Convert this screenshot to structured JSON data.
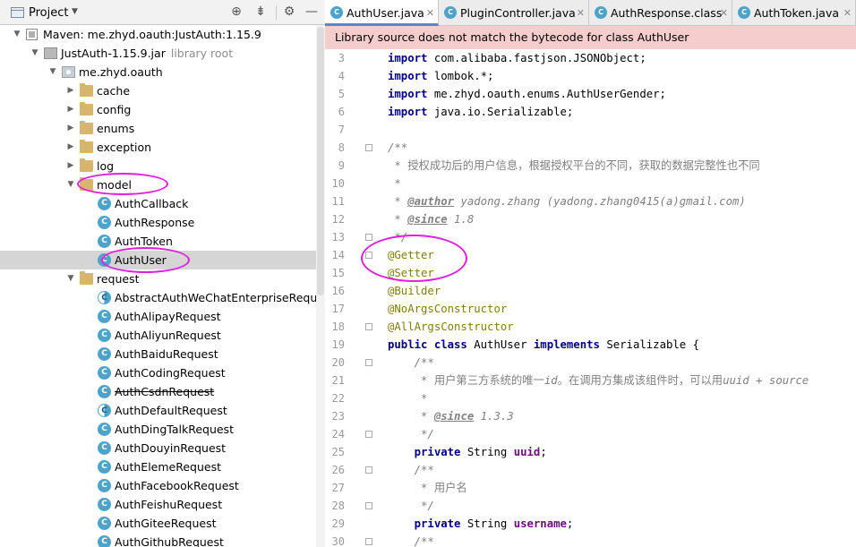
{
  "project_panel": {
    "title": "Project",
    "tree": [
      {
        "depth": 0,
        "arrow": "down",
        "icon": "maven",
        "label": "Maven: me.zhyd.oauth:JustAuth:1.15.9"
      },
      {
        "depth": 1,
        "arrow": "down",
        "icon": "jar",
        "label": "JustAuth-1.15.9.jar",
        "suffix": "library root"
      },
      {
        "depth": 2,
        "arrow": "down",
        "icon": "package",
        "label": "me.zhyd.oauth"
      },
      {
        "depth": 3,
        "arrow": "right",
        "icon": "folder",
        "label": "cache"
      },
      {
        "depth": 3,
        "arrow": "right",
        "icon": "folder",
        "label": "config"
      },
      {
        "depth": 3,
        "arrow": "right",
        "icon": "folder",
        "label": "enums"
      },
      {
        "depth": 3,
        "arrow": "right",
        "icon": "folder",
        "label": "exception"
      },
      {
        "depth": 3,
        "arrow": "right",
        "icon": "folder",
        "label": "log"
      },
      {
        "depth": 3,
        "arrow": "down",
        "icon": "folder",
        "label": "model"
      },
      {
        "depth": 4,
        "icon": "class",
        "label": "AuthCallback"
      },
      {
        "depth": 4,
        "icon": "class",
        "label": "AuthResponse"
      },
      {
        "depth": 4,
        "icon": "class",
        "label": "AuthToken"
      },
      {
        "depth": 4,
        "icon": "class",
        "label": "AuthUser",
        "selected": true
      },
      {
        "depth": 3,
        "arrow": "down",
        "icon": "folder",
        "label": "request"
      },
      {
        "depth": 4,
        "icon": "abstract-class",
        "label": "AbstractAuthWeChatEnterpriseRequest"
      },
      {
        "depth": 4,
        "icon": "class",
        "label": "AuthAlipayRequest"
      },
      {
        "depth": 4,
        "icon": "class",
        "label": "AuthAliyunRequest"
      },
      {
        "depth": 4,
        "icon": "class",
        "label": "AuthBaiduRequest"
      },
      {
        "depth": 4,
        "icon": "class",
        "label": "AuthCodingRequest"
      },
      {
        "depth": 4,
        "icon": "class",
        "label": "AuthCsdnRequest",
        "deprecated": true
      },
      {
        "depth": 4,
        "icon": "abstract-class",
        "label": "AuthDefaultRequest"
      },
      {
        "depth": 4,
        "icon": "class",
        "label": "AuthDingTalkRequest"
      },
      {
        "depth": 4,
        "icon": "class",
        "label": "AuthDouyinRequest"
      },
      {
        "depth": 4,
        "icon": "class",
        "label": "AuthElemeRequest"
      },
      {
        "depth": 4,
        "icon": "class",
        "label": "AuthFacebookRequest"
      },
      {
        "depth": 4,
        "icon": "class",
        "label": "AuthFeishuRequest"
      },
      {
        "depth": 4,
        "icon": "class",
        "label": "AuthGiteeRequest"
      },
      {
        "depth": 4,
        "icon": "class",
        "label": "AuthGithubRequest"
      }
    ]
  },
  "editor": {
    "tabs": [
      {
        "label": "AuthUser.java",
        "active": true
      },
      {
        "label": "PluginController.java"
      },
      {
        "label": "AuthResponse.class"
      },
      {
        "label": "AuthToken.java"
      }
    ],
    "banner": "Library source does not match the bytecode for class AuthUser",
    "lines": [
      {
        "n": "3",
        "tokens": [
          [
            "kw",
            "import"
          ],
          [
            "t",
            " com.alibaba.fastjson.JSONObject;"
          ]
        ]
      },
      {
        "n": "4",
        "tokens": [
          [
            "kw",
            "import"
          ],
          [
            "t",
            " lombok.*;"
          ]
        ]
      },
      {
        "n": "5",
        "tokens": [
          [
            "kw",
            "import"
          ],
          [
            "t",
            " me.zhyd.oauth.enums.AuthUserGender;"
          ]
        ]
      },
      {
        "n": "6",
        "tokens": [
          [
            "kw",
            "import"
          ],
          [
            "t",
            " java.io.Serializable;"
          ]
        ]
      },
      {
        "n": "7",
        "tokens": []
      },
      {
        "n": "8",
        "tokens": [
          [
            "cm",
            "/**"
          ]
        ]
      },
      {
        "n": "9",
        "tokens": [
          [
            "cm",
            " * "
          ],
          [
            "cn",
            "授权成功后的用户信息，根据授权平台的不同，获取的数据完整性也不同"
          ]
        ]
      },
      {
        "n": "10",
        "tokens": [
          [
            "cm",
            " *"
          ]
        ]
      },
      {
        "n": "11",
        "tokens": [
          [
            "cm",
            " * "
          ],
          [
            "cmb",
            "@author"
          ],
          [
            "cm",
            " yadong.zhang (yadong.zhang0415(a)gmail.com)"
          ]
        ]
      },
      {
        "n": "12",
        "tokens": [
          [
            "cm",
            " * "
          ],
          [
            "cmb",
            "@since"
          ],
          [
            "cm",
            " 1.8"
          ]
        ]
      },
      {
        "n": "13",
        "tokens": [
          [
            "cm",
            " */"
          ]
        ]
      },
      {
        "n": "14",
        "tokens": [
          [
            "an",
            "@Getter"
          ]
        ]
      },
      {
        "n": "15",
        "tokens": [
          [
            "an",
            "@Setter"
          ]
        ]
      },
      {
        "n": "16",
        "tokens": [
          [
            "an",
            "@Builder"
          ]
        ]
      },
      {
        "n": "17",
        "tokens": [
          [
            "an",
            "@NoArgsConstructor"
          ]
        ]
      },
      {
        "n": "18",
        "tokens": [
          [
            "an",
            "@AllArgsConstructor"
          ]
        ]
      },
      {
        "n": "19",
        "tokens": [
          [
            "kw",
            "public class"
          ],
          [
            "t",
            " AuthUser "
          ],
          [
            "kw",
            "implements"
          ],
          [
            "t",
            " Serializable {"
          ]
        ]
      },
      {
        "n": "20",
        "tokens": [
          [
            "cm",
            "    /**"
          ]
        ]
      },
      {
        "n": "21",
        "tokens": [
          [
            "cm",
            "     * "
          ],
          [
            "cn",
            "用户第三方系统的唯一"
          ],
          [
            "cm",
            "id"
          ],
          [
            "cn",
            "。在调用方集成该组件时，可以用"
          ],
          [
            "cm",
            "uuid + source"
          ]
        ]
      },
      {
        "n": "22",
        "tokens": [
          [
            "cm",
            "     *"
          ]
        ]
      },
      {
        "n": "23",
        "tokens": [
          [
            "cm",
            "     * "
          ],
          [
            "cmb",
            "@since"
          ],
          [
            "cm",
            " 1.3.3"
          ]
        ]
      },
      {
        "n": "24",
        "tokens": [
          [
            "cm",
            "     */"
          ]
        ]
      },
      {
        "n": "25",
        "tokens": [
          [
            "t",
            "    "
          ],
          [
            "kw",
            "private"
          ],
          [
            "t",
            " String "
          ],
          [
            "fd",
            "uuid"
          ],
          [
            "t",
            ";"
          ]
        ]
      },
      {
        "n": "26",
        "tokens": [
          [
            "cm",
            "    /**"
          ]
        ]
      },
      {
        "n": "27",
        "tokens": [
          [
            "cm",
            "     * "
          ],
          [
            "cn",
            "用户名"
          ]
        ]
      },
      {
        "n": "28",
        "tokens": [
          [
            "cm",
            "     */"
          ]
        ]
      },
      {
        "n": "29",
        "tokens": [
          [
            "t",
            "    "
          ],
          [
            "kw",
            "private"
          ],
          [
            "t",
            " String "
          ],
          [
            "fd",
            "username"
          ],
          [
            "t",
            ";"
          ]
        ]
      },
      {
        "n": "30",
        "tokens": [
          [
            "cm",
            "    /**"
          ]
        ]
      }
    ]
  }
}
